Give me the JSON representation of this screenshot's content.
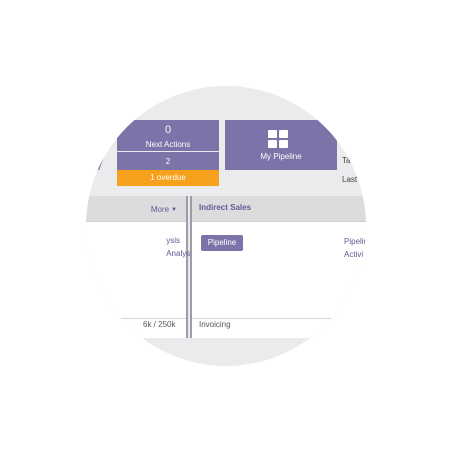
{
  "tiles": {
    "next_actions": {
      "count": "0",
      "label": "Next Actions",
      "sub_count": "2",
      "overdue": "1 overdue"
    },
    "my_pipeline": {
      "label": "My Pipeline",
      "icon": "grid-icon"
    }
  },
  "side_labels": [
    "Ta",
    "Last"
  ],
  "left_panel": {
    "more_label": "More",
    "links": [
      "ysis",
      "Analysis"
    ],
    "footer_value": "6k / 250k"
  },
  "right_panel": {
    "title": "Indirect Sales",
    "button_label": "Pipeline",
    "links": [
      "Pipelin",
      "Activi"
    ],
    "footer_label": "Invoicing"
  },
  "colors": {
    "tile": "#7a74a8",
    "overdue": "#f7a01c",
    "link": "#5f5a93",
    "lens_bg": "#ebebed"
  }
}
